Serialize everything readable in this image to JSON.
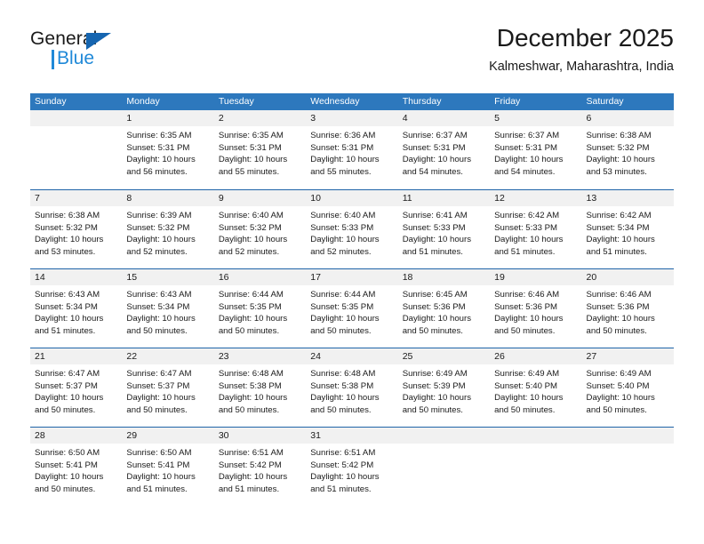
{
  "brand": {
    "name_top": "General",
    "name_bottom": "Blue",
    "accent_color": "#2089d8",
    "triangle_color": "#1565b0"
  },
  "header": {
    "title": "December 2025",
    "subtitle": "Kalmeshwar, Maharashtra, India"
  },
  "calendar": {
    "header_bg": "#2d78bd",
    "header_text_color": "#ffffff",
    "date_band_bg": "#f1f1f1",
    "week_divider_color": "#1f64a8",
    "weekdays": [
      "Sunday",
      "Monday",
      "Tuesday",
      "Wednesday",
      "Thursday",
      "Friday",
      "Saturday"
    ],
    "weeks": [
      [
        {
          "date": "",
          "lines": []
        },
        {
          "date": "1",
          "lines": [
            "Sunrise: 6:35 AM",
            "Sunset: 5:31 PM",
            "Daylight: 10 hours",
            "and 56 minutes."
          ]
        },
        {
          "date": "2",
          "lines": [
            "Sunrise: 6:35 AM",
            "Sunset: 5:31 PM",
            "Daylight: 10 hours",
            "and 55 minutes."
          ]
        },
        {
          "date": "3",
          "lines": [
            "Sunrise: 6:36 AM",
            "Sunset: 5:31 PM",
            "Daylight: 10 hours",
            "and 55 minutes."
          ]
        },
        {
          "date": "4",
          "lines": [
            "Sunrise: 6:37 AM",
            "Sunset: 5:31 PM",
            "Daylight: 10 hours",
            "and 54 minutes."
          ]
        },
        {
          "date": "5",
          "lines": [
            "Sunrise: 6:37 AM",
            "Sunset: 5:31 PM",
            "Daylight: 10 hours",
            "and 54 minutes."
          ]
        },
        {
          "date": "6",
          "lines": [
            "Sunrise: 6:38 AM",
            "Sunset: 5:32 PM",
            "Daylight: 10 hours",
            "and 53 minutes."
          ]
        }
      ],
      [
        {
          "date": "7",
          "lines": [
            "Sunrise: 6:38 AM",
            "Sunset: 5:32 PM",
            "Daylight: 10 hours",
            "and 53 minutes."
          ]
        },
        {
          "date": "8",
          "lines": [
            "Sunrise: 6:39 AM",
            "Sunset: 5:32 PM",
            "Daylight: 10 hours",
            "and 52 minutes."
          ]
        },
        {
          "date": "9",
          "lines": [
            "Sunrise: 6:40 AM",
            "Sunset: 5:32 PM",
            "Daylight: 10 hours",
            "and 52 minutes."
          ]
        },
        {
          "date": "10",
          "lines": [
            "Sunrise: 6:40 AM",
            "Sunset: 5:33 PM",
            "Daylight: 10 hours",
            "and 52 minutes."
          ]
        },
        {
          "date": "11",
          "lines": [
            "Sunrise: 6:41 AM",
            "Sunset: 5:33 PM",
            "Daylight: 10 hours",
            "and 51 minutes."
          ]
        },
        {
          "date": "12",
          "lines": [
            "Sunrise: 6:42 AM",
            "Sunset: 5:33 PM",
            "Daylight: 10 hours",
            "and 51 minutes."
          ]
        },
        {
          "date": "13",
          "lines": [
            "Sunrise: 6:42 AM",
            "Sunset: 5:34 PM",
            "Daylight: 10 hours",
            "and 51 minutes."
          ]
        }
      ],
      [
        {
          "date": "14",
          "lines": [
            "Sunrise: 6:43 AM",
            "Sunset: 5:34 PM",
            "Daylight: 10 hours",
            "and 51 minutes."
          ]
        },
        {
          "date": "15",
          "lines": [
            "Sunrise: 6:43 AM",
            "Sunset: 5:34 PM",
            "Daylight: 10 hours",
            "and 50 minutes."
          ]
        },
        {
          "date": "16",
          "lines": [
            "Sunrise: 6:44 AM",
            "Sunset: 5:35 PM",
            "Daylight: 10 hours",
            "and 50 minutes."
          ]
        },
        {
          "date": "17",
          "lines": [
            "Sunrise: 6:44 AM",
            "Sunset: 5:35 PM",
            "Daylight: 10 hours",
            "and 50 minutes."
          ]
        },
        {
          "date": "18",
          "lines": [
            "Sunrise: 6:45 AM",
            "Sunset: 5:36 PM",
            "Daylight: 10 hours",
            "and 50 minutes."
          ]
        },
        {
          "date": "19",
          "lines": [
            "Sunrise: 6:46 AM",
            "Sunset: 5:36 PM",
            "Daylight: 10 hours",
            "and 50 minutes."
          ]
        },
        {
          "date": "20",
          "lines": [
            "Sunrise: 6:46 AM",
            "Sunset: 5:36 PM",
            "Daylight: 10 hours",
            "and 50 minutes."
          ]
        }
      ],
      [
        {
          "date": "21",
          "lines": [
            "Sunrise: 6:47 AM",
            "Sunset: 5:37 PM",
            "Daylight: 10 hours",
            "and 50 minutes."
          ]
        },
        {
          "date": "22",
          "lines": [
            "Sunrise: 6:47 AM",
            "Sunset: 5:37 PM",
            "Daylight: 10 hours",
            "and 50 minutes."
          ]
        },
        {
          "date": "23",
          "lines": [
            "Sunrise: 6:48 AM",
            "Sunset: 5:38 PM",
            "Daylight: 10 hours",
            "and 50 minutes."
          ]
        },
        {
          "date": "24",
          "lines": [
            "Sunrise: 6:48 AM",
            "Sunset: 5:38 PM",
            "Daylight: 10 hours",
            "and 50 minutes."
          ]
        },
        {
          "date": "25",
          "lines": [
            "Sunrise: 6:49 AM",
            "Sunset: 5:39 PM",
            "Daylight: 10 hours",
            "and 50 minutes."
          ]
        },
        {
          "date": "26",
          "lines": [
            "Sunrise: 6:49 AM",
            "Sunset: 5:40 PM",
            "Daylight: 10 hours",
            "and 50 minutes."
          ]
        },
        {
          "date": "27",
          "lines": [
            "Sunrise: 6:49 AM",
            "Sunset: 5:40 PM",
            "Daylight: 10 hours",
            "and 50 minutes."
          ]
        }
      ],
      [
        {
          "date": "28",
          "lines": [
            "Sunrise: 6:50 AM",
            "Sunset: 5:41 PM",
            "Daylight: 10 hours",
            "and 50 minutes."
          ]
        },
        {
          "date": "29",
          "lines": [
            "Sunrise: 6:50 AM",
            "Sunset: 5:41 PM",
            "Daylight: 10 hours",
            "and 51 minutes."
          ]
        },
        {
          "date": "30",
          "lines": [
            "Sunrise: 6:51 AM",
            "Sunset: 5:42 PM",
            "Daylight: 10 hours",
            "and 51 minutes."
          ]
        },
        {
          "date": "31",
          "lines": [
            "Sunrise: 6:51 AM",
            "Sunset: 5:42 PM",
            "Daylight: 10 hours",
            "and 51 minutes."
          ]
        },
        {
          "date": "",
          "lines": []
        },
        {
          "date": "",
          "lines": []
        },
        {
          "date": "",
          "lines": []
        }
      ]
    ]
  }
}
